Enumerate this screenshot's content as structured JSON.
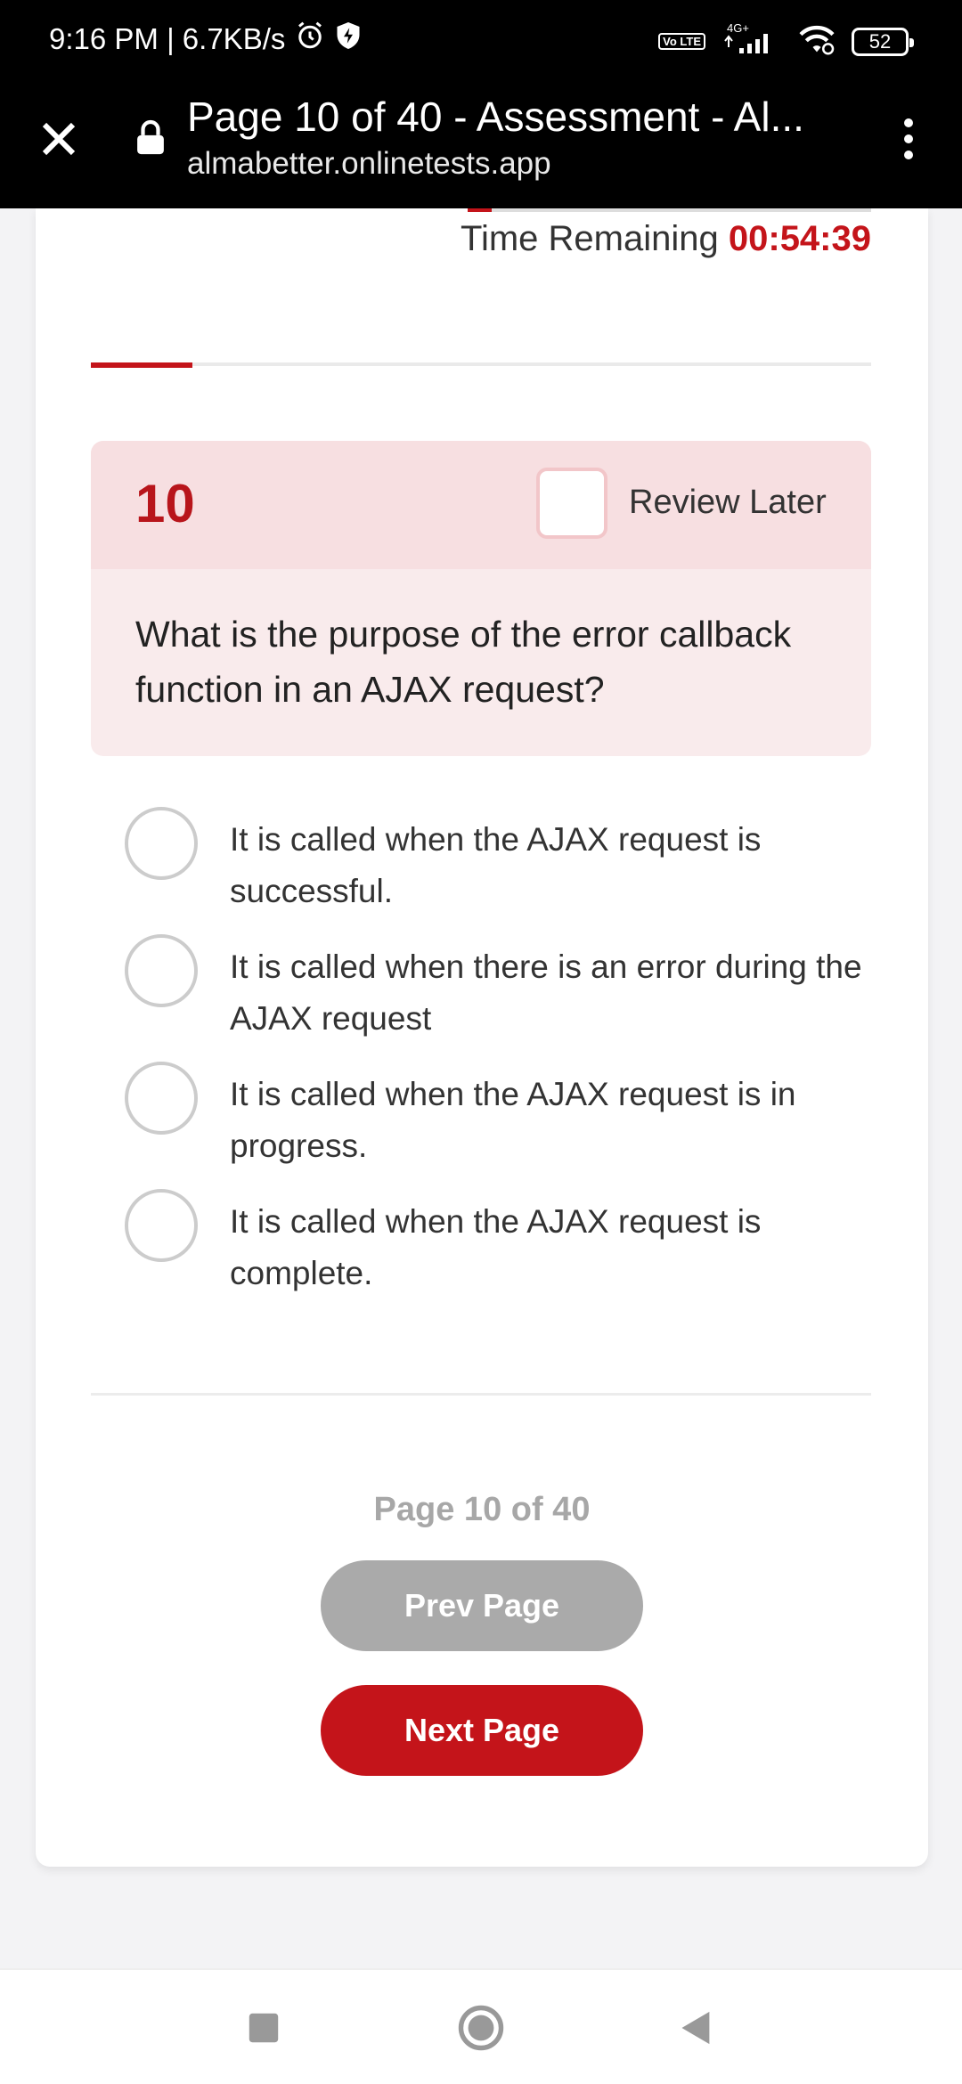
{
  "status_bar": {
    "time_speed": "9:16 PM | 6.7KB/s",
    "network_type": "4G+",
    "volte": "Vo LTE",
    "battery": "52",
    "icons": [
      "alarm-icon",
      "shield-icon",
      "signal-icon",
      "wifi-icon",
      "battery-icon"
    ]
  },
  "browser": {
    "title": "Page 10 of 40 - Assessment - Al...",
    "url": "almabetter.onlinetests.app",
    "icons": [
      "close-icon",
      "lock-icon",
      "more-vert-icon"
    ]
  },
  "timer": {
    "label": "Time Remaining",
    "value": "00:54:39",
    "elapsed_fraction": 0.06
  },
  "progress": {
    "fraction": 0.13
  },
  "question": {
    "number": "10",
    "review_label": "Review Later",
    "review_checked": false,
    "text": "What is the purpose of the error callback function in an AJAX request?",
    "options": [
      {
        "text": "It is called when the AJAX request is successful."
      },
      {
        "text": "It is called when there is an error during the AJAX request"
      },
      {
        "text": "It is called when the AJAX request is in progress."
      },
      {
        "text": "It is called when the AJAX request is complete."
      }
    ]
  },
  "pagination": {
    "info": "Page 10 of 40",
    "prev_label": "Prev Page",
    "next_label": "Next Page"
  },
  "nav_bar": {
    "icons": [
      "recents-icon",
      "home-icon",
      "back-icon"
    ]
  },
  "colors": {
    "accent": "#c4141a",
    "question_header_bg": "#f7dfe1",
    "question_body_bg": "#f9ebec",
    "disabled_button": "#aaaaaa"
  }
}
